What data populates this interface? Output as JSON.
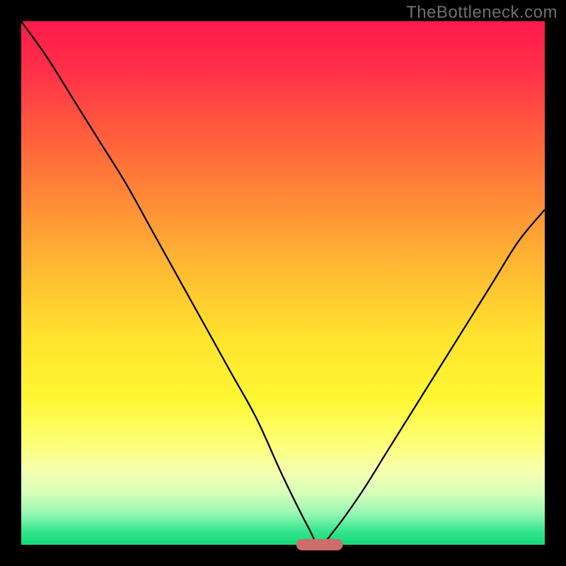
{
  "watermark": "TheBottleneck.com",
  "chart_data": {
    "type": "line",
    "title": "",
    "xlabel": "",
    "ylabel": "",
    "xlim": [
      0,
      100
    ],
    "ylim": [
      0,
      100
    ],
    "grid": false,
    "legend": false,
    "series": [
      {
        "name": "bottleneck-curve",
        "x": [
          0,
          5,
          10,
          15,
          20,
          25,
          30,
          35,
          40,
          45,
          50,
          55,
          57,
          60,
          65,
          70,
          75,
          80,
          85,
          90,
          95,
          100
        ],
        "values": [
          100,
          93,
          85,
          77,
          69,
          60,
          51,
          42,
          33,
          24,
          13,
          3,
          0,
          3,
          10,
          18,
          26,
          34,
          42,
          50,
          58,
          64
        ]
      }
    ],
    "marker": {
      "x": 57,
      "y": 0,
      "width_pct": 9,
      "height_pct": 2.2,
      "color": "#cb6e6c"
    },
    "gradient_stops": [
      {
        "pos": 0.0,
        "color": "#ff1a4c"
      },
      {
        "pos": 0.1,
        "color": "#ff3247"
      },
      {
        "pos": 0.25,
        "color": "#ff6a3a"
      },
      {
        "pos": 0.45,
        "color": "#ffb233"
      },
      {
        "pos": 0.6,
        "color": "#ffe22e"
      },
      {
        "pos": 0.72,
        "color": "#fff733"
      },
      {
        "pos": 0.8,
        "color": "#fdff70"
      },
      {
        "pos": 0.86,
        "color": "#f6ffb0"
      },
      {
        "pos": 0.9,
        "color": "#d7ffb8"
      },
      {
        "pos": 0.94,
        "color": "#98f7b4"
      },
      {
        "pos": 0.975,
        "color": "#33e58f"
      },
      {
        "pos": 1.0,
        "color": "#15d977"
      }
    ],
    "curve_style": {
      "stroke": "#000000",
      "stroke_width": 2.3
    }
  }
}
